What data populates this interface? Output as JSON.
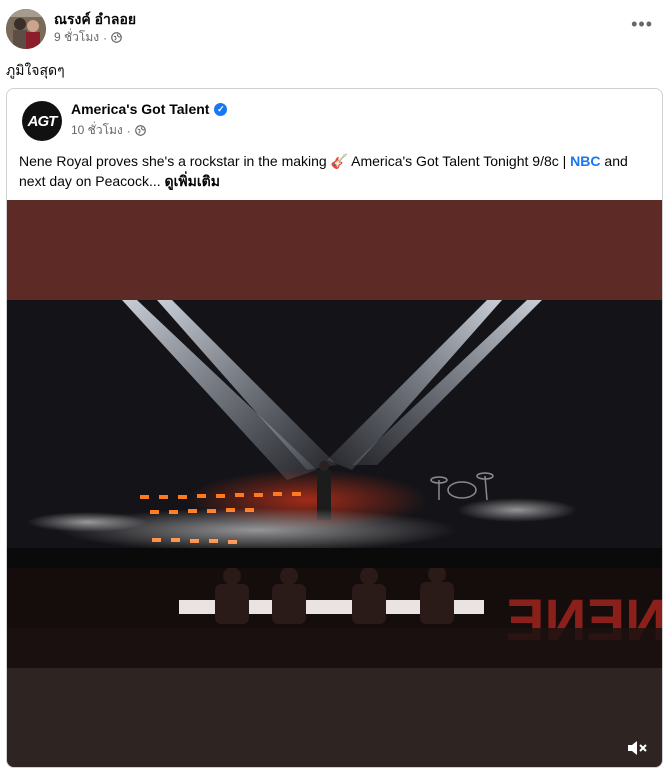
{
  "post": {
    "author": "ณรงค์ อำลอย",
    "time": "9 ชั่วโมง",
    "separator": "·",
    "privacy_icon": "globe-icon",
    "menu_icon": "more-dots-icon",
    "menu_label": "•••",
    "caption": "ภูมิใจสุดๆ"
  },
  "shared": {
    "page_name": "America's Got Talent",
    "page_logo": "AGT",
    "verified_icon": "verified-badge-icon",
    "time": "10 ชั่วโมง",
    "separator": "·",
    "text_before_link": "Nene Royal proves she's a rockstar in the making 🎸 America's Got Talent Tonight 9/8c | ",
    "link_text": "NBC",
    "text_after_link": " and next day on Peacock...",
    "see_more": "ดูเพิ่มเติม"
  },
  "video": {
    "watermark": "NENE",
    "mute_icon": "volume-muted-icon",
    "colors": {
      "top_band": "#5e2a26",
      "bottom_band": "#2e2522",
      "stage_light": "#d8e2f0",
      "stage_led": "#ff6a1a"
    }
  }
}
